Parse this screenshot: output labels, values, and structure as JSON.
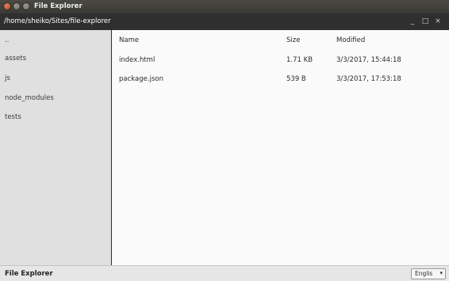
{
  "window": {
    "title": "File Explorer"
  },
  "appbar": {
    "path": "/home/sheiko/Sites/file-explorer",
    "minimize_glyph": "_",
    "maximize_glyph": "□",
    "close_glyph": "×"
  },
  "sidebar": {
    "items": [
      {
        "label": ".."
      },
      {
        "label": "assets"
      },
      {
        "label": "js"
      },
      {
        "label": "node_modules"
      },
      {
        "label": "tests"
      }
    ]
  },
  "table": {
    "headers": {
      "name": "Name",
      "size": "Size",
      "modified": "Modified"
    },
    "rows": [
      {
        "name": "index.html",
        "size": "1.71 KB",
        "modified": "3/3/2017, 15:44:18"
      },
      {
        "name": "package.json",
        "size": "539 B",
        "modified": "3/3/2017, 17:53:18"
      }
    ]
  },
  "footer": {
    "title": "File Explorer",
    "language_select": {
      "value": "Englis",
      "caret": "▾"
    }
  },
  "icons": [
    "close-icon",
    "minimize-icon",
    "maximize-icon",
    "chevron-down-icon"
  ]
}
